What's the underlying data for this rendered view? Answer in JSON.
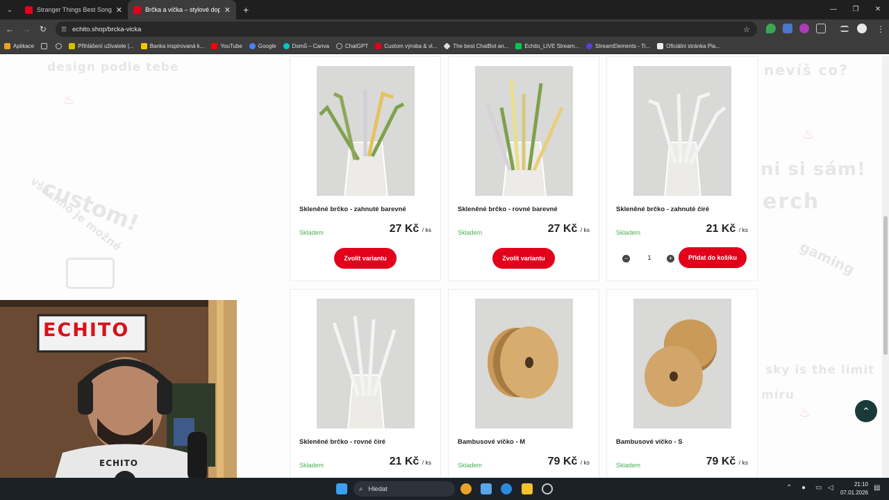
{
  "browser": {
    "tabs": [
      {
        "title": "Stranger Things Best Songs Pla",
        "color": "#e3001b"
      },
      {
        "title": "Brčka a víčka – stylové doplňky",
        "color": "#e3001b"
      }
    ],
    "url": "echito.shop/brcka-vicka",
    "bookmarks": [
      {
        "label": "Aplikace",
        "color": "#e9a227"
      },
      {
        "label": "Přihlášení uživatele |...",
        "color": "#d4c200"
      },
      {
        "label": "Banka inspirovaná k...",
        "color": "#f5c400"
      },
      {
        "label": "YouTube",
        "color": "#ff0000"
      },
      {
        "label": "Google",
        "color": "#4285f4"
      },
      {
        "label": "Domů – Canva",
        "color": "#00c4cc"
      },
      {
        "label": "ChatGPT",
        "color": "#bbbbbb"
      },
      {
        "label": "Custom výroba & vl...",
        "color": "#e3001b"
      },
      {
        "label": "The best ChatBot an...",
        "color": "#dddddd"
      },
      {
        "label": "Echito_LIVE Stream...",
        "color": "#00c853"
      },
      {
        "label": "StreamElements - Ti...",
        "color": "#5b3dd6"
      },
      {
        "label": "Oficiální stránka Pla...",
        "color": "#eeeeee"
      }
    ]
  },
  "background_text": {
    "t1": "design podle tebe",
    "t2": "custom!",
    "t3": "všechno je možné",
    "t4": "nevíš co?",
    "t5": "ni si sám!",
    "t6": "erch",
    "t7": "gaming",
    "t8": "sky is the limit",
    "t9": "míru"
  },
  "products": [
    {
      "name": "Skleněné brčko - zahnuté barevné",
      "stock": "Skladem",
      "price": "27 Kč",
      "unit": "/ ks",
      "button": "Zvolit variantu"
    },
    {
      "name": "Skleněné brčko - rovné barevné",
      "stock": "Skladem",
      "price": "27 Kč",
      "unit": "/ ks",
      "button": "Zvolit variantu"
    },
    {
      "name": "Skleněné brčko - zahnuté čiré",
      "stock": "Skladem",
      "price": "21 Kč",
      "unit": "/ ks",
      "button": "Přidat do košíku",
      "quantity": "1"
    },
    {
      "name": "Skleněné brčko - rovné čiré",
      "stock": "Skladem",
      "price": "21 Kč",
      "unit": "/ ks"
    },
    {
      "name": "Bambusové víčko - M",
      "stock": "Skladem",
      "price": "79 Kč",
      "unit": "/ ks"
    },
    {
      "name": "Bambusové víčko - S",
      "stock": "Skladem",
      "price": "79 Kč",
      "unit": "/ ks"
    }
  ],
  "webcam": {
    "sign": "ECHITO",
    "shirt": "ECHITO"
  },
  "taskbar": {
    "search_placeholder": "Hledat",
    "time": "21:10",
    "date": "07.01.2026"
  }
}
